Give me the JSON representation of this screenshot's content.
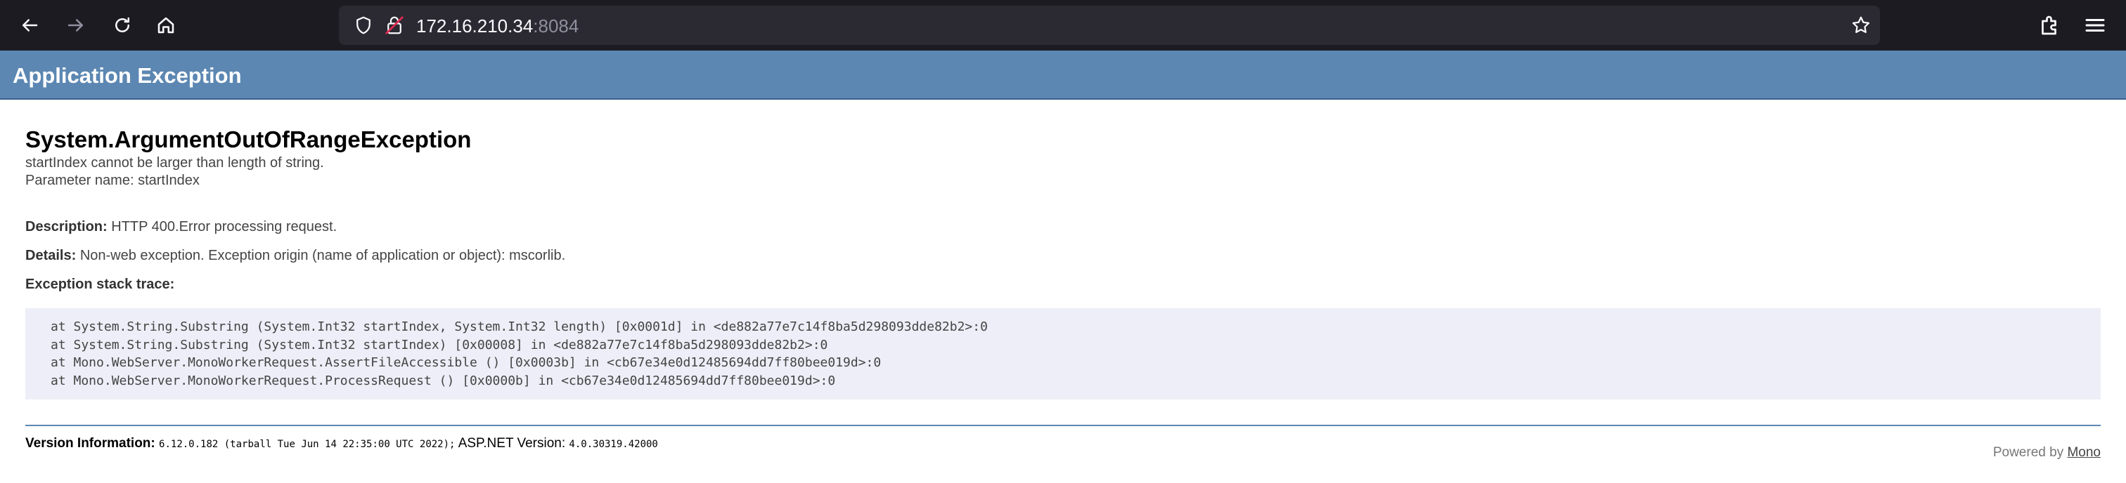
{
  "browser": {
    "url_host": "172.16.210.34",
    "url_port": ":8084"
  },
  "page": {
    "header_title": "Application Exception",
    "exception_title": "System.ArgumentOutOfRangeException",
    "exception_message_line1": "startIndex cannot be larger than length of string.",
    "exception_message_line2": "Parameter name: startIndex",
    "description_label": "Description:",
    "description_value": "HTTP 400.Error processing request.",
    "details_label": "Details:",
    "details_value": "Non-web exception. Exception origin (name of application or object): mscorlib.",
    "stack_label": "Exception stack trace:",
    "stack_lines": [
      "at System.String.Substring (System.Int32 startIndex, System.Int32 length) [0x0001d] in <de882a77e7c14f8ba5d298093dde82b2>:0",
      "at System.String.Substring (System.Int32 startIndex) [0x00008] in <de882a77e7c14f8ba5d298093dde82b2>:0",
      "at Mono.WebServer.MonoWorkerRequest.AssertFileAccessible () [0x0003b] in <cb67e34e0d12485694dd7ff80bee019d>:0",
      "at Mono.WebServer.MonoWorkerRequest.ProcessRequest () [0x0000b] in <cb67e34e0d12485694dd7ff80bee019d>:0"
    ],
    "version_label": "Version Information:",
    "version_value": "6.12.0.182 (tarball Tue Jun 14 22:35:00 UTC 2022);",
    "aspnet_label": "ASP.NET Version:",
    "aspnet_value": "4.0.30319.42000",
    "powered_by": "Powered by",
    "powered_link": "Mono"
  },
  "icons": {
    "back": "arrow-left-icon",
    "forward": "arrow-right-icon",
    "reload": "reload-icon",
    "home": "home-icon",
    "shield": "shield-icon",
    "lock": "insecure-lock-icon",
    "bookmark": "star-icon",
    "extensions": "extensions-icon",
    "menu": "hamburger-menu-icon"
  },
  "colors": {
    "header_bar": "#5c87b2",
    "stack_bg": "#eeeef8",
    "chrome_bg": "#1c1b22",
    "urlbar_bg": "#2b2a33",
    "insecure_lock": "#e22850"
  }
}
